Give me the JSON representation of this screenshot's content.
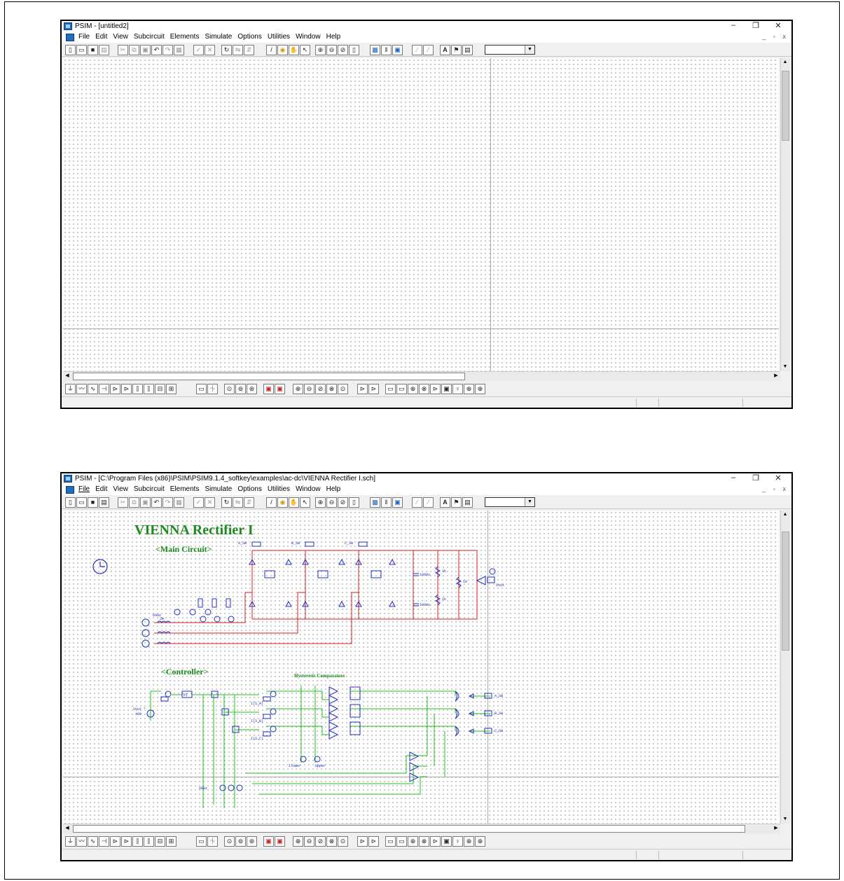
{
  "window1": {
    "title": "PSIM - [untitled2]",
    "menu": [
      "File",
      "Edit",
      "View",
      "Subcircuit",
      "Elements",
      "Simulate",
      "Options",
      "Utilities",
      "Window",
      "Help"
    ]
  },
  "window2": {
    "title": "PSIM - [C:\\Program Files (x86)\\PSIM\\PSIM9.1.4_softkey\\examples\\ac-dc\\VIENNA Rectifier I.sch]",
    "menu": [
      "File",
      "Edit",
      "View",
      "Subcircuit",
      "Elements",
      "Simulate",
      "Options",
      "Utilities",
      "Window",
      "Help"
    ],
    "schematic": {
      "title": "VIENNA Rectifier I",
      "main_circuit_label": "<Main Circuit>",
      "controller_label": "<Controller>",
      "hysteresis_label": "Hysteresis Comparators",
      "switch_labels": [
        "A_SW",
        "B_SW",
        "C_SW"
      ],
      "cap_labels": [
        "1000u",
        "1000u"
      ],
      "res_labels": [
        "1k",
        "1k",
        "10"
      ],
      "vout_label": "Vout",
      "vref_label": "Vout *",
      "vref_value": "400",
      "freq_label": "60Hz",
      "inductor_label": "2m",
      "iref_labels": [
        "I(S_A)",
        "I(S_B)",
        "I(S_C)"
      ],
      "lower_label": "Ilower",
      "upper_label": "Upper",
      "pi_label": "PI"
    }
  },
  "window_controls": {
    "minimize": "–",
    "restore": "❐",
    "close": "✕",
    "mdi": "_ ▫ x"
  },
  "colors": {
    "power": "#d42020",
    "control": "#20c020",
    "component": "#2030c0",
    "title": "#1f8a1f"
  }
}
